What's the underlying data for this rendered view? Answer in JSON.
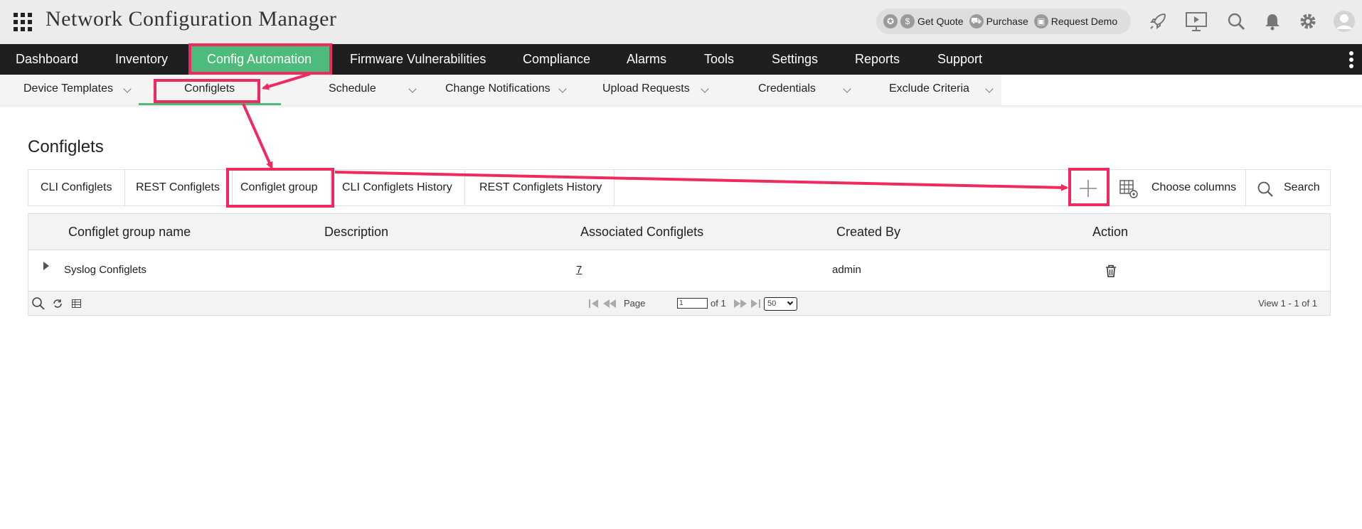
{
  "app": {
    "title": "Network Configuration Manager"
  },
  "promo": {
    "get_quote": "Get Quote",
    "purchase": "Purchase",
    "request_demo": "Request Demo"
  },
  "nav": {
    "items": [
      "Dashboard",
      "Inventory",
      "Config Automation",
      "Firmware Vulnerabilities",
      "Compliance",
      "Alarms",
      "Tools",
      "Settings",
      "Reports",
      "Support"
    ],
    "active": "Config Automation"
  },
  "subnav": {
    "items": [
      "Device Templates",
      "Configlets",
      "Schedule",
      "Change Notifications",
      "Upload Requests",
      "Credentials",
      "Exclude Criteria"
    ],
    "active": "Configlets"
  },
  "page": {
    "title": "Configlets"
  },
  "tabs": {
    "items": [
      "CLI Configlets",
      "REST Configlets",
      "Configlet group",
      "CLI Configlets History",
      "REST Configlets History"
    ],
    "active": "Configlet group"
  },
  "toolbar": {
    "choose_columns": "Choose columns",
    "search": "Search"
  },
  "table": {
    "columns": [
      "Configlet group name",
      "Description",
      "Associated Configlets",
      "Created By",
      "Action"
    ],
    "rows": [
      {
        "name": "Syslog Configlets",
        "description": "",
        "associated": "7",
        "created_by": "admin"
      }
    ]
  },
  "pager": {
    "page_label": "Page",
    "page_value": "1",
    "of_label": "of 1",
    "page_size": "50",
    "view_text": "View 1 - 1 of 1"
  },
  "colors": {
    "nav_bg": "#1f1f1f",
    "accent": "#4cbb7c",
    "annotation": "#ee2a5f"
  }
}
